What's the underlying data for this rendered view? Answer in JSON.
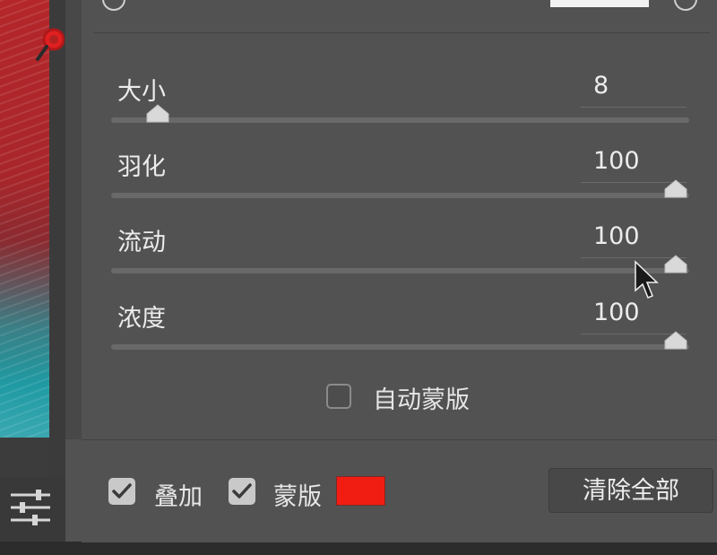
{
  "brush_panel": {
    "sliders": [
      {
        "label": "大小",
        "value": "8",
        "level_percent": 8
      },
      {
        "label": "羽化",
        "value": "100",
        "level_percent": 100
      },
      {
        "label": "流动",
        "value": "100",
        "level_percent": 100
      },
      {
        "label": "浓度",
        "value": "100",
        "level_percent": 100
      }
    ],
    "auto_mask": {
      "label": "自动蒙版",
      "checked": false
    }
  },
  "options": {
    "overlay": {
      "label": "叠加",
      "checked": true
    },
    "mask": {
      "label": "蒙版",
      "checked": true,
      "color": "#f11d13"
    },
    "clear_all_label": "清除全部"
  },
  "icons": {
    "zoom": "zoom-icon",
    "settings": "sliders-settings-icon",
    "cursor": "mouse-pointer-icon"
  },
  "colors": {
    "panel_bg": "#535253",
    "slider_track": "#6a696a",
    "mask_color": "#f11d13"
  }
}
